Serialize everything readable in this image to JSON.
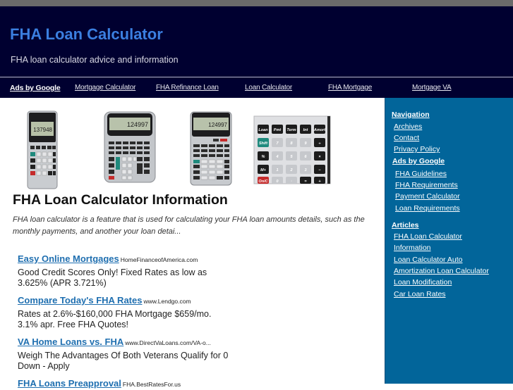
{
  "header": {
    "title": "FHA Loan Calculator",
    "tagline": "FHA loan calculator advice and information"
  },
  "navbar": {
    "ads_label": "Ads by Google",
    "links": [
      "Mortgage Calculator",
      "FHA Refinance Loan",
      "Loan Calculator",
      "FHA Mortgage",
      "Mortgage VA"
    ]
  },
  "main": {
    "images": [
      {
        "alt": "handheld mortgage calculator",
        "display": "137948"
      },
      {
        "alt": "desktop real estate calculator",
        "display": "124997"
      },
      {
        "alt": "qualifier plus calculator",
        "display": "124997"
      },
      {
        "alt": "calculator keypad close-up",
        "keys": [
          "Loan Amt",
          "Pmt",
          "Term",
          "Int",
          "Amort",
          "Shift",
          "7",
          "8",
          "9",
          "÷",
          "%",
          "4",
          "5",
          "6",
          "×",
          "M+",
          "1",
          "2",
          "3",
          "−",
          "On/C",
          "0",
          "·",
          "=",
          "+"
        ]
      }
    ],
    "title": "FHA Loan Calculator Information",
    "intro": "FHA loan calculator is a feature that is used for calculating your FHA loan amounts details, such as the monthly payments, and another your loan detai...",
    "ads": [
      {
        "title": "Easy Online Mortgages",
        "url": "HomeFinanceofAmerica.com",
        "desc": "Good Credit Scores Only! Fixed Rates as low as 3.625% (APR 3.721%)"
      },
      {
        "title": "Compare Today's FHA Rates",
        "url": "www.Lendgo.com",
        "desc": "Rates at 2.6%-$160,000 FHA Mortgage $659/mo. 3.1% apr. Free FHA Quotes!"
      },
      {
        "title": "VA Home Loans vs. FHA",
        "url": "www.DirectVaLoans.com/VA-o...",
        "desc": "Weigh The Advantages Of Both Veterans Qualify for 0 Down - Apply"
      },
      {
        "title": "FHA Loans Preapproval",
        "url": "FHA.BestRatesFor.us",
        "desc": ""
      }
    ]
  },
  "sidebar": {
    "navigation_heading": "Navigation",
    "navigation": [
      "Archives",
      "Contact",
      "Privacy Policy"
    ],
    "ads_heading": "Ads by Google",
    "ads": [
      "FHA Guidelines",
      "FHA Requirements",
      "Payment Calculator",
      "Loan Requirements"
    ],
    "articles_heading": "Articles",
    "articles": [
      "FHA Loan Calculator",
      "Information",
      "Loan Calculator Auto",
      "Amortization Loan Calculator",
      "Loan Modification",
      "Car Loan Rates"
    ]
  }
}
